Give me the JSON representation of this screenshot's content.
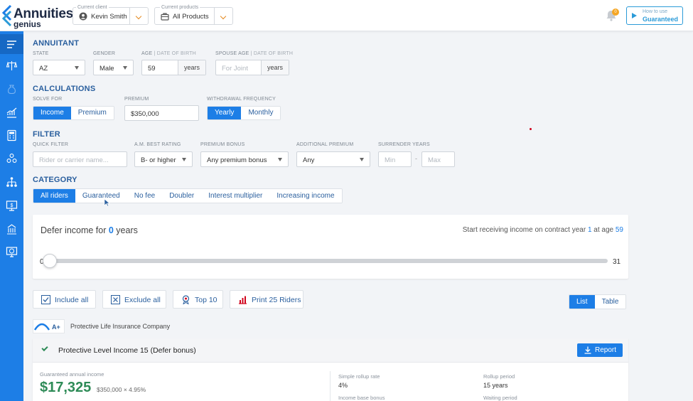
{
  "brand": {
    "line1": "Annuities",
    "line2": "genius",
    "accent": "#1d7ee6"
  },
  "header": {
    "current_client_caption": "Current client",
    "current_client": "Kevin Smith",
    "current_products_caption": "Current products",
    "current_products": "All Products",
    "notification_count": "0",
    "howto_small": "How to use",
    "howto_big": "Guaranteed"
  },
  "sidebar": {
    "icons": [
      "menu-icon",
      "scale-icon",
      "money-bag-icon",
      "chart-growth-icon",
      "calculator-icon",
      "blocks-icon",
      "hierarchy-icon",
      "presentation-icon",
      "building-icon",
      "monitor-dollar-icon"
    ]
  },
  "annuitant": {
    "title": "ANNUITANT",
    "state_caption": "STATE",
    "state": "AZ",
    "gender_caption": "GENDER",
    "gender": "Male",
    "age_caption": "AGE",
    "age_caption_dim": " | DATE OF BIRTH",
    "age": "59",
    "age_suffix": "years",
    "spouse_caption": "SPOUSE AGE",
    "spouse_caption_dim": " | DATE OF BIRTH",
    "spouse_placeholder": "For Joint",
    "spouse_suffix": "years"
  },
  "calculations": {
    "title": "CALCULATIONS",
    "solve_caption": "SOLVE FOR",
    "solve_options": [
      "Income",
      "Premium"
    ],
    "solve_selected": "Income",
    "premium_caption": "PREMIUM",
    "premium": "$350,000",
    "withdrawal_caption": "WITHDRAWAL FREQUENCY",
    "withdrawal_options": [
      "Yearly",
      "Monthly"
    ],
    "withdrawal_selected": "Yearly"
  },
  "filter": {
    "title": "FILTER",
    "quick_caption": "QUICK FILTER",
    "quick_placeholder": "Rider or carrier name...",
    "rating_caption": "A.M. BEST RATING",
    "rating": "B- or higher",
    "bonus_caption": "PREMIUM BONUS",
    "bonus": "Any premium bonus",
    "additional_caption": "ADDITIONAL PREMIUM",
    "additional": "Any",
    "surrender_caption": "SURRENDER YEARS",
    "surrender_min_placeholder": "Min",
    "surrender_sep": "-",
    "surrender_max_placeholder": "Max"
  },
  "category": {
    "title": "CATEGORY",
    "tabs": [
      "All riders",
      "Guaranteed",
      "No fee",
      "Doubler",
      "Interest multiplier",
      "Increasing income"
    ],
    "selected": "All riders"
  },
  "defer": {
    "label_prefix": "Defer income for ",
    "years": "0",
    "label_suffix": " years",
    "start_prefix": "Start receiving income on contract year ",
    "start_year": "1",
    "start_mid": " at age ",
    "start_age": "59",
    "slider_min": "0",
    "slider_max": "31",
    "slider_value": 0
  },
  "actions": {
    "include_all": "Include all",
    "exclude_all": "Exclude all",
    "top10": "Top 10",
    "print": "Print 25 Riders",
    "view_list": "List",
    "view_table": "Table",
    "view_selected": "List"
  },
  "company": {
    "grade": "A+",
    "name": "Protective Life Insurance Company"
  },
  "product": {
    "title": "Protective Level Income 15 (Defer bonus)",
    "report_label": "Report",
    "gai_caption": "Guaranteed annual income",
    "gai_value": "$17,325",
    "gai_formula": "$350,000 × 4.95%",
    "stats": [
      {
        "caption": "Simple rollup rate",
        "value": "4%"
      },
      {
        "caption": "Rollup period",
        "value": "15 years"
      },
      {
        "caption": "Income base bonus",
        "value": ""
      },
      {
        "caption": "Waiting period",
        "value": ""
      }
    ]
  }
}
